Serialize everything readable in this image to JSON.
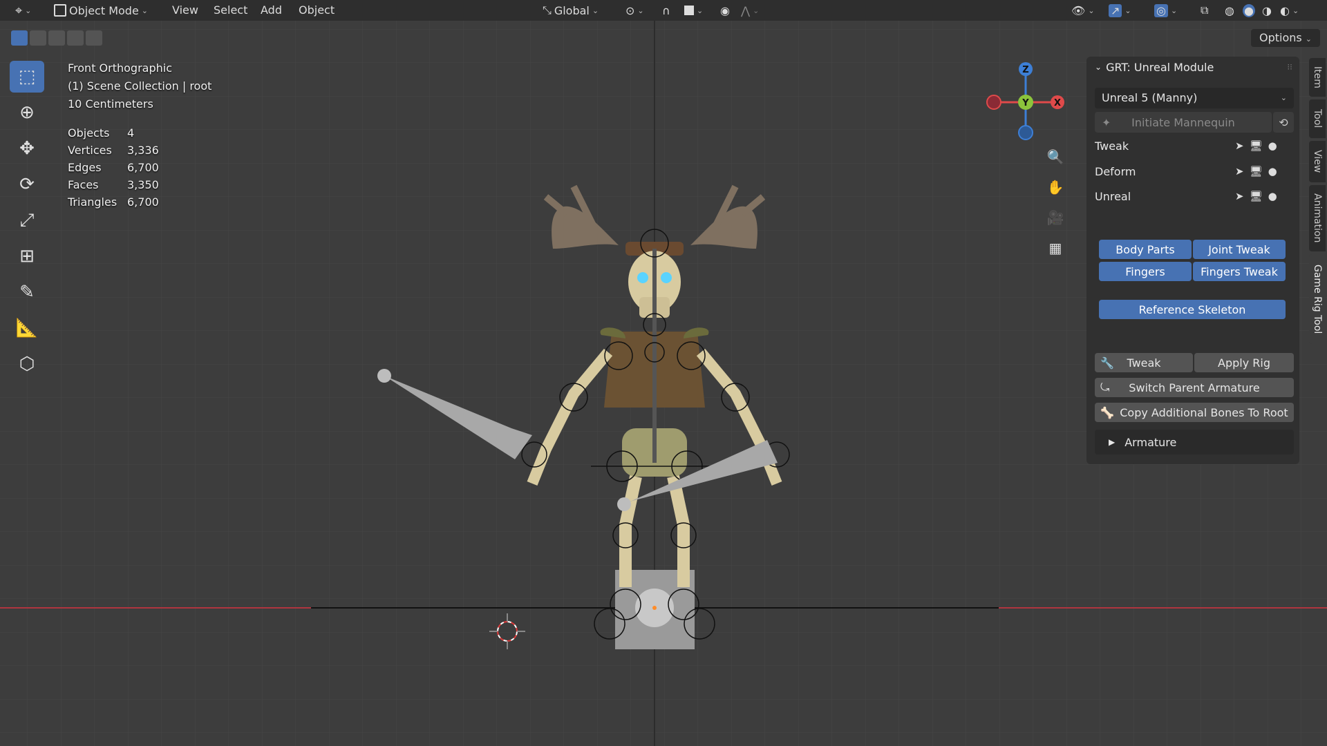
{
  "topbar": {
    "mode": "Object Mode",
    "menu": [
      "View",
      "Select",
      "Add",
      "Object"
    ],
    "transform_orientation": "Global",
    "options_label": "Options"
  },
  "overlay": {
    "view_name": "Front Orthographic",
    "collection": "(1) Scene Collection | root",
    "scale": "10 Centimeters",
    "stats": [
      {
        "label": "Objects",
        "value": "4"
      },
      {
        "label": "Vertices",
        "value": "3,336"
      },
      {
        "label": "Edges",
        "value": "6,700"
      },
      {
        "label": "Faces",
        "value": "3,350"
      },
      {
        "label": "Triangles",
        "value": "6,700"
      }
    ]
  },
  "gizmo": {
    "z": "Z",
    "y": "Y",
    "x": "X"
  },
  "panel": {
    "title": "GRT: Unreal Module",
    "preset": "Unreal 5 (Manny)",
    "initiate": "Initiate Mannequin",
    "collections": [
      "Tweak",
      "Deform",
      "Unreal"
    ],
    "body_parts": "Body Parts",
    "joint_tweak": "Joint Tweak",
    "fingers": "Fingers",
    "fingers_tweak": "Fingers Tweak",
    "reference_skeleton": "Reference Skeleton",
    "tweak": "Tweak",
    "apply_rig": "Apply Rig",
    "switch_parent": "Switch Parent Armature",
    "copy_bones": "Copy Additional Bones To Root",
    "armature": "Armature"
  },
  "side_tabs": [
    "Item",
    "Tool",
    "View",
    "Animation",
    "Game Rig Tool"
  ],
  "colors": {
    "accent": "#4772b3",
    "x_axis": "#e04a4a",
    "y_axis": "#8cc43c",
    "z_axis": "#3d7fd6"
  }
}
